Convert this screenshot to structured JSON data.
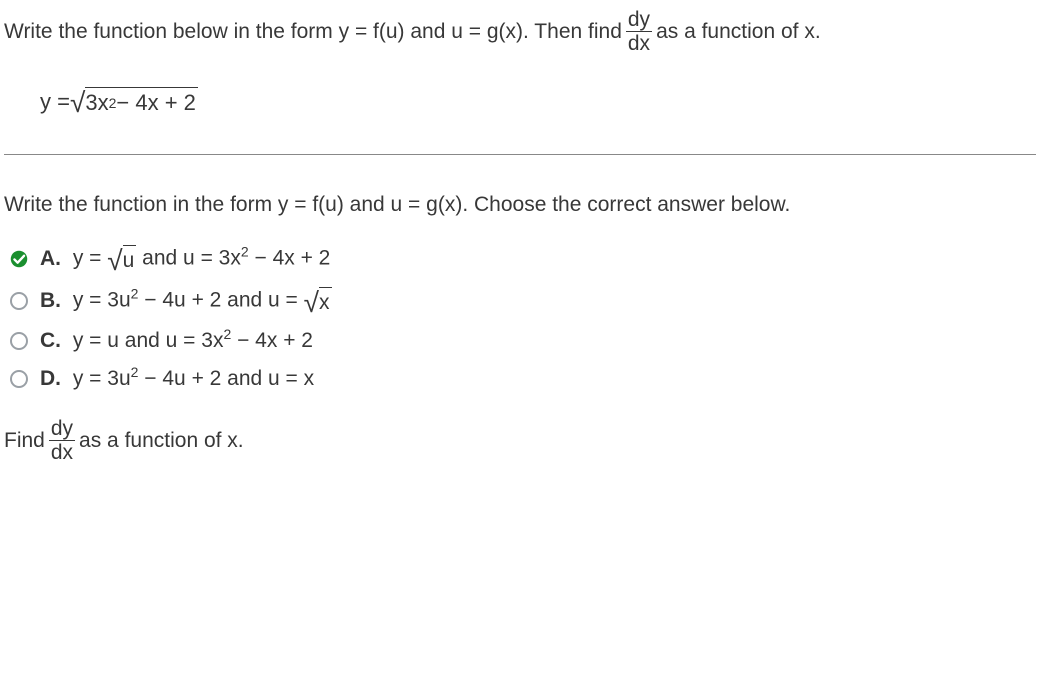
{
  "problem": {
    "intro_a": "Write the function below in the form y = f(u) and u = g(x). Then find ",
    "frac_num": "dy",
    "frac_den": "dx",
    "intro_b": " as a function of x.",
    "equation_prefix": "y = ",
    "radicand": "3x",
    "radicand_exp": "2",
    "radicand_tail": " − 4x + 2"
  },
  "question": "Write the function in the form y = f(u) and u = g(x). Choose the correct answer below.",
  "options": {
    "A": {
      "letter": "A.",
      "p1": "y = ",
      "sqrt_body": "u",
      "p2": " and u = 3x",
      "exp": "2",
      "p3": " − 4x + 2",
      "selected": true
    },
    "B": {
      "letter": "B.",
      "p1": "y = 3u",
      "exp": "2",
      "p2": " − 4u + 2 and u = ",
      "sqrt_body": "x",
      "selected": false
    },
    "C": {
      "letter": "C.",
      "p1": "y = u and u = 3x",
      "exp": "2",
      "p2": " − 4x + 2",
      "selected": false
    },
    "D": {
      "letter": "D.",
      "p1": "y = 3u",
      "exp": "2",
      "p2": " − 4u + 2 and u = x",
      "selected": false
    }
  },
  "final": {
    "prefix": "Find ",
    "frac_num": "dy",
    "frac_den": "dx",
    "suffix": " as a function of x."
  }
}
